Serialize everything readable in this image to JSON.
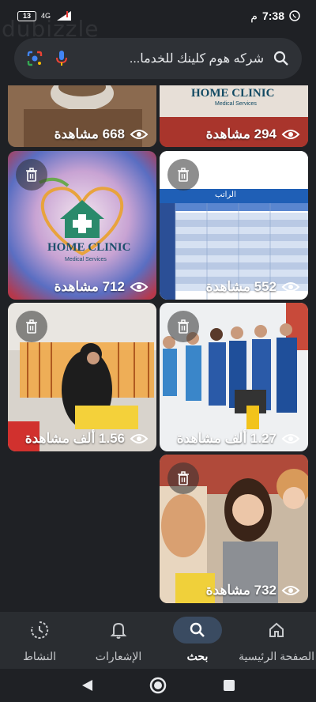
{
  "status": {
    "time": "7:38",
    "time_suffix": "م",
    "battery": "13",
    "network": "4G"
  },
  "watermark": "dubizzle",
  "search": {
    "query": "شركه هوم كلينك للخدما..."
  },
  "cards": [
    {
      "views": "668 مشاهدة",
      "has_delete": false
    },
    {
      "views": "294 مشاهدة",
      "has_delete": false
    },
    {
      "views": "712 مشاهدة",
      "has_delete": true
    },
    {
      "views": "552 مشاهدة",
      "has_delete": true
    },
    {
      "views": "1.56 ألف مشاهدة",
      "has_delete": true
    },
    {
      "views": "1.27 ألف مشاهدة",
      "has_delete": true
    },
    {
      "views": "732 مشاهدة",
      "has_delete": true
    }
  ],
  "image_text": {
    "brand_1": "HOME CLINIC",
    "brand_1_sub": "Medical Services",
    "brand_2": "HOME CLINIC",
    "brand_2_sub": "Medical Services",
    "table_header": "الراتب"
  },
  "bottom_nav": [
    {
      "label": "الصفحة الرئيسية",
      "icon": "home-icon"
    },
    {
      "label": "بحث",
      "icon": "search-icon"
    },
    {
      "label": "الإشعارات",
      "icon": "bell-icon"
    },
    {
      "label": "النشاط",
      "icon": "activity-icon"
    }
  ],
  "colors": {
    "background": "#1f2125",
    "search_bg": "#2e3136",
    "nav_bg": "#2a2d31",
    "active_pill": "#3a4b61"
  }
}
